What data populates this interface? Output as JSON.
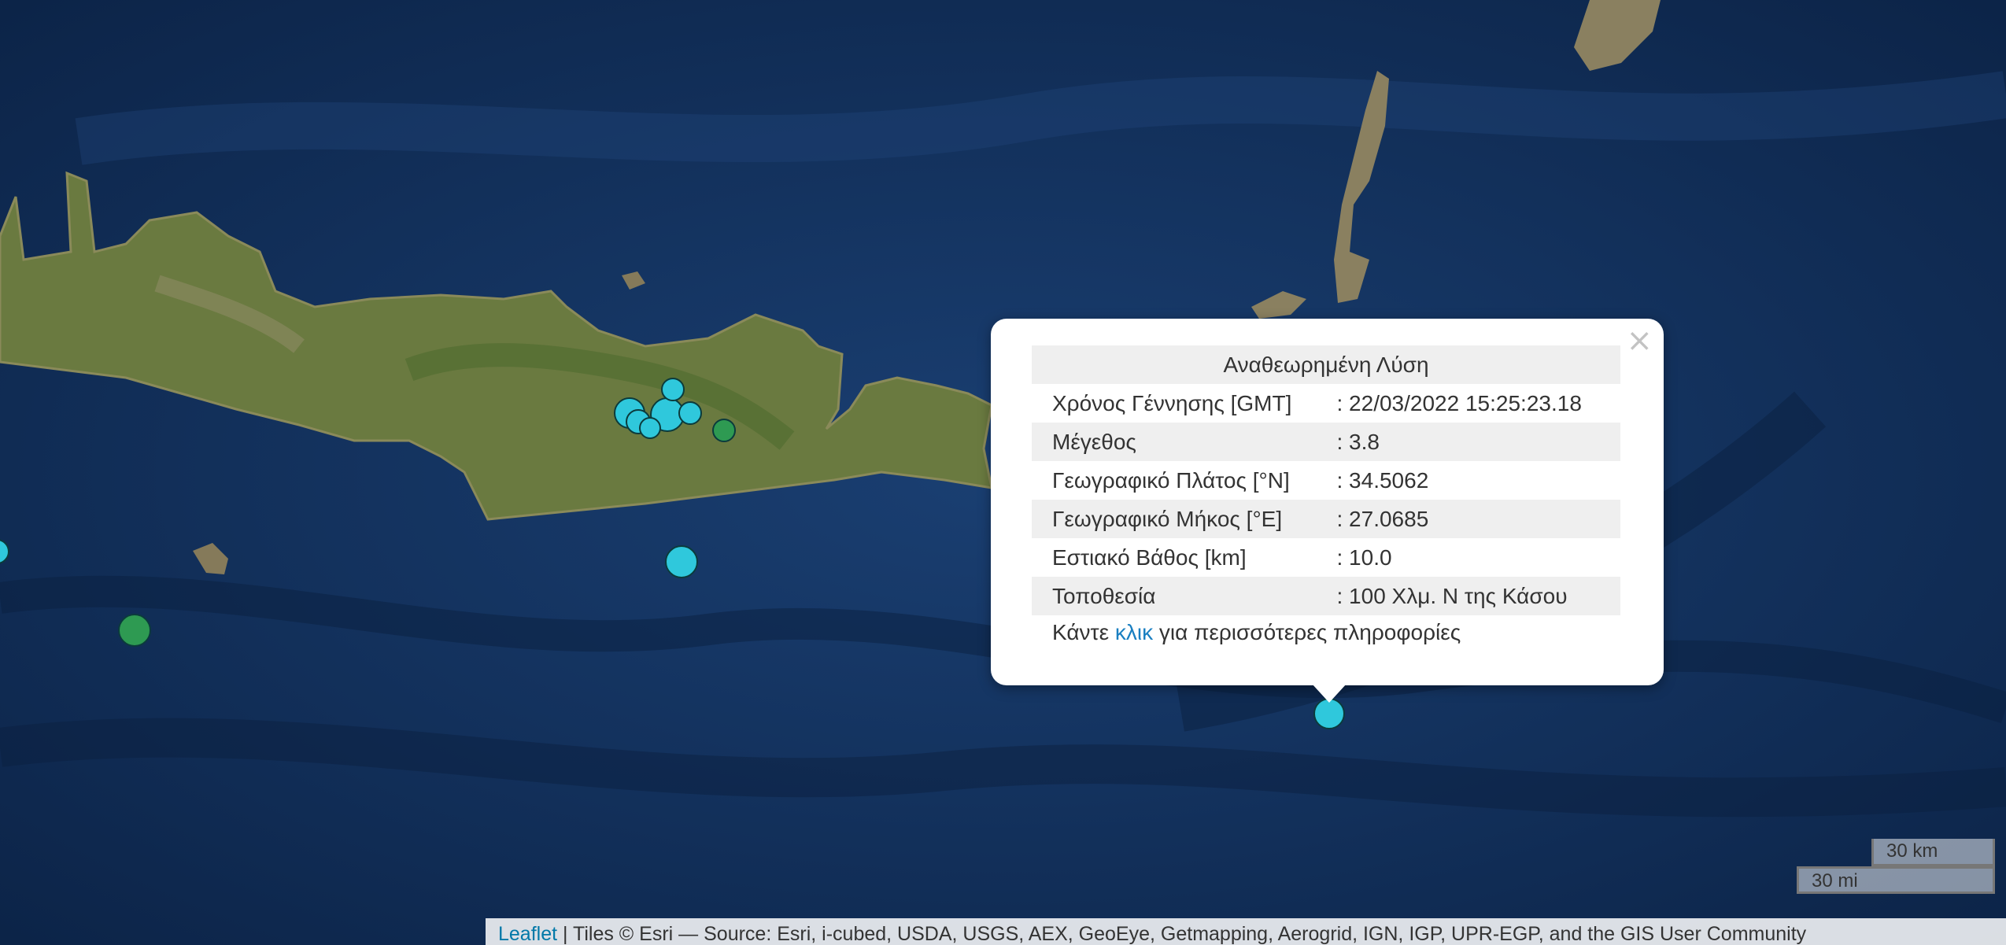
{
  "popup": {
    "title": "Αναθεωρημένη Λύση",
    "close_symbol": "×",
    "rows": [
      {
        "label": "Χρόνος Γέννησης [GMT]",
        "value": ": 22/03/2022 15:25:23.18"
      },
      {
        "label": "Μέγεθος",
        "value": ": 3.8"
      },
      {
        "label": "Γεωγραφικό Πλάτος [°N]",
        "value": ": 34.5062"
      },
      {
        "label": "Γεωγραφικό Μήκος [°E]",
        "value": ": 27.0685"
      },
      {
        "label": "Εστιακό Βάθος [km]",
        "value": ": 10.0"
      },
      {
        "label": "Τοποθεσία",
        "value": ": 100 Χλμ. Ν της Κάσου"
      }
    ],
    "footer_pre": "Κάντε",
    "footer_link": "κλικ",
    "footer_post": "για περισσότερες πληροφορίες"
  },
  "scale": {
    "km": "30 km",
    "mi": "30 mi"
  },
  "attribution": {
    "link": "Leaflet",
    "text": " | Tiles © Esri — Source: Esri, i-cubed, USDA, USGS, AEX, GeoEye, Getmapping, Aerogrid, IGN, IGP, UPR-EGP, and the GIS User Community"
  },
  "colors": {
    "sea": "#12305a",
    "land": "#6a7a40",
    "quake_cyan": "#2fc8dc",
    "quake_green": "#2e9a52",
    "popup_title": "#1f8a1f",
    "link": "#1a7fc1"
  }
}
